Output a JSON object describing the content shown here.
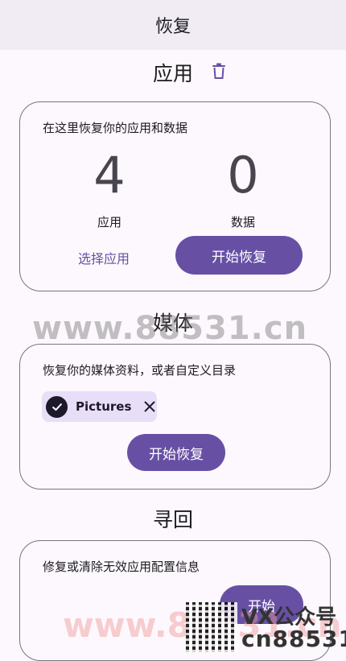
{
  "topbar": {
    "title": "恢复"
  },
  "apps_section": {
    "title": "应用",
    "description": "在这里恢复你的应用和数据",
    "apps_count": "4",
    "apps_label": "应用",
    "data_count": "0",
    "data_label": "数据",
    "select_apps": "选择应用",
    "start_restore": "开始恢复"
  },
  "media_section": {
    "title": "媒体",
    "description": "恢复你的媒体资料，或者自定义目录",
    "chip_label": "Pictures",
    "start_restore": "开始恢复"
  },
  "retrieve_section": {
    "title": "寻回",
    "description": "修复或清除无效应用配置信息",
    "start": "开始"
  },
  "watermark": {
    "text": "www.88531.cn",
    "side_top": "VX公众号",
    "side_bottom": "cn88531"
  },
  "colors": {
    "primary": "#6750a4",
    "chip_bg": "#e8def8",
    "topbar_bg": "#f1ecf4"
  }
}
